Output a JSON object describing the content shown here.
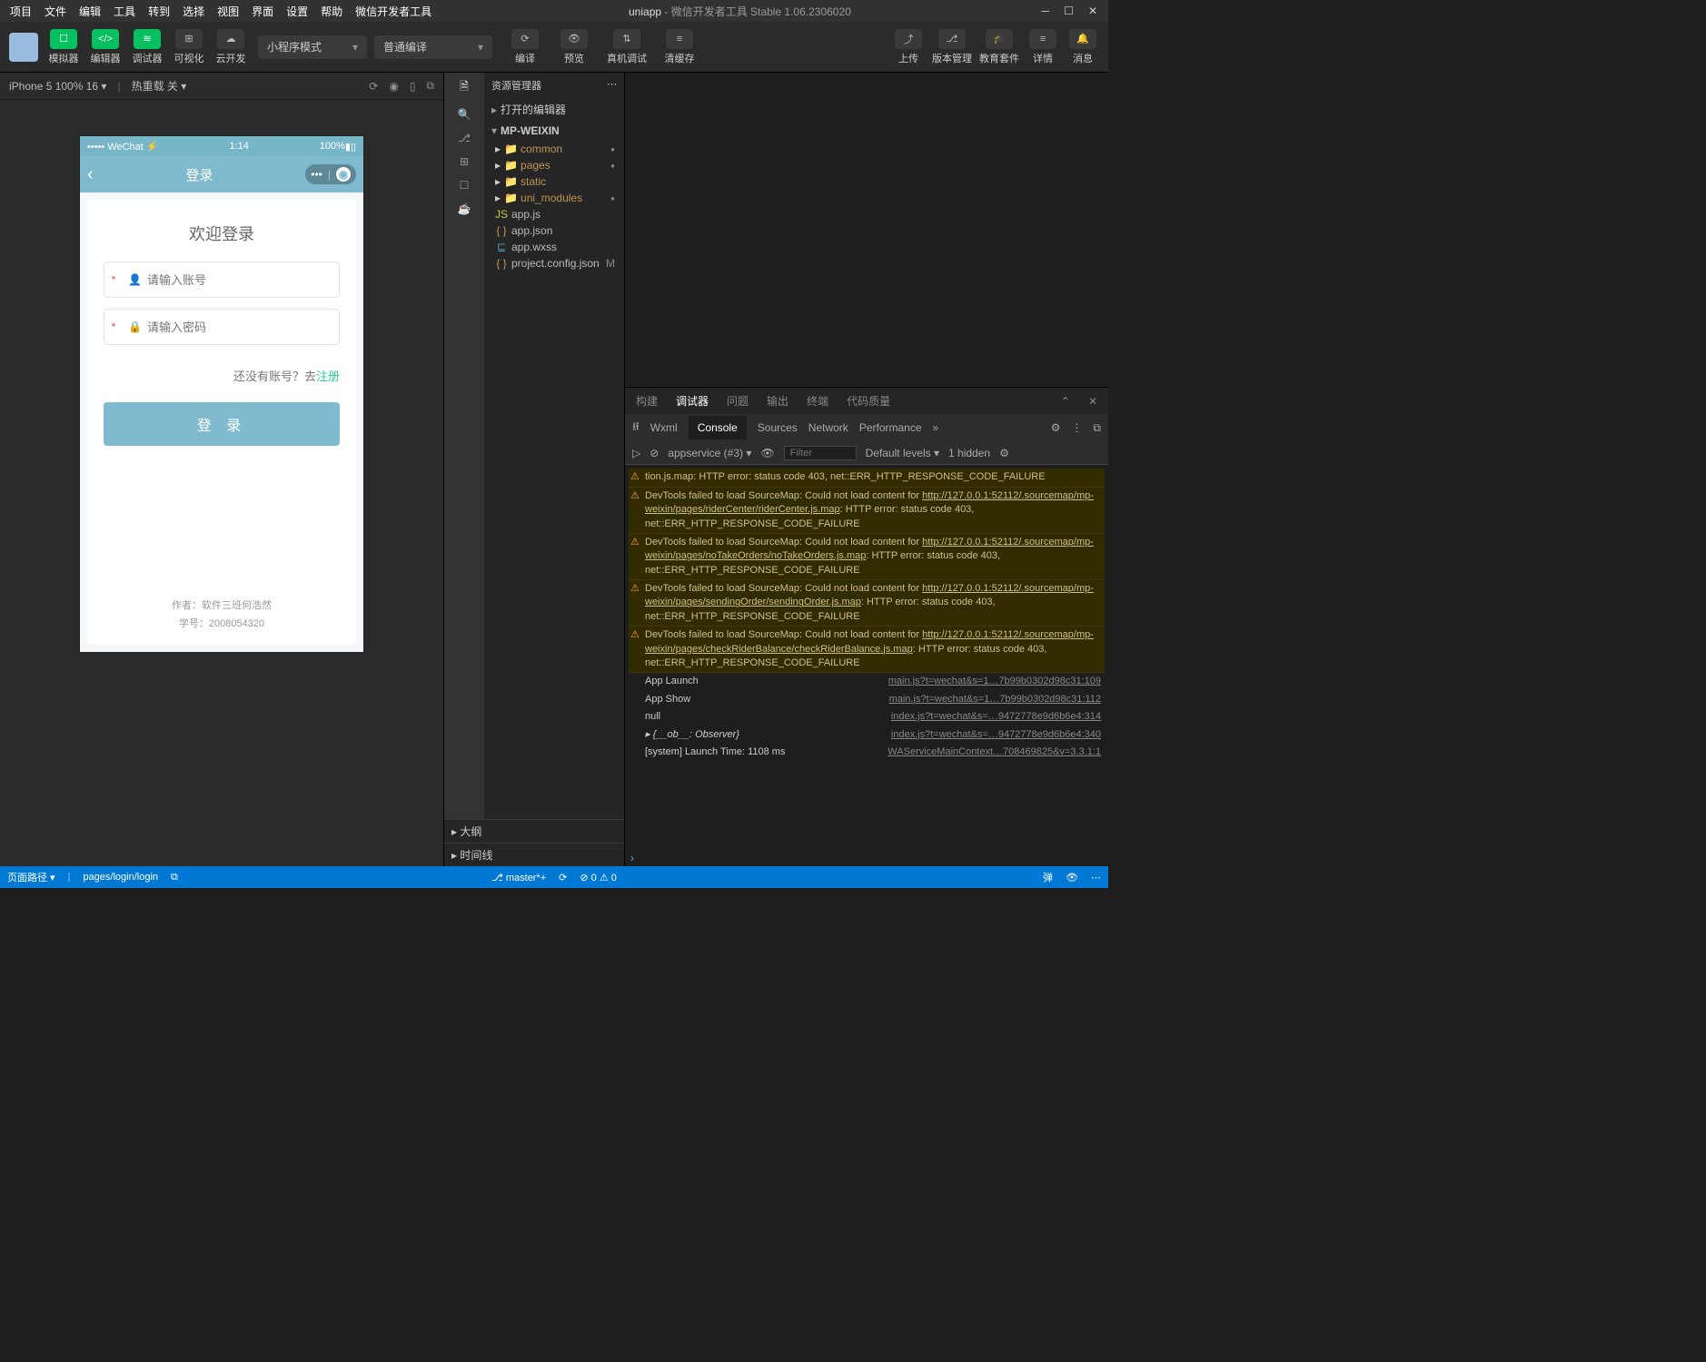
{
  "title": {
    "app": "uniapp",
    "suffix": "微信开发者工具 Stable 1.06.2306020"
  },
  "menu": [
    "项目",
    "文件",
    "编辑",
    "工具",
    "转到",
    "选择",
    "视图",
    "界面",
    "设置",
    "帮助",
    "微信开发者工具"
  ],
  "toolbar": {
    "simulator": "模拟器",
    "editor": "编辑器",
    "debugger": "调试器",
    "visual": "可视化",
    "cloud": "云开发",
    "mode": "小程序模式",
    "compileType": "普通编译",
    "compile": "编译",
    "preview": "预览",
    "realdev": "真机调试",
    "clear": "清缓存",
    "upload": "上传",
    "version": "版本管理",
    "edu": "教育套件",
    "detail": "详情",
    "msg": "消息"
  },
  "simbar": {
    "device": "iPhone 5 100% 16",
    "hot": "热重载 关"
  },
  "phone": {
    "carrier": "WeChat",
    "time": "1:14",
    "battery": "100%",
    "nav": "登录",
    "welcome": "欢迎登录",
    "ph_user": "请输入账号",
    "ph_pwd": "请输入密码",
    "noacct": "还没有账号？去",
    "reg": "注册",
    "login": "登 录",
    "author": "作者：软件三班何浩然",
    "sid": "学号：2008054320"
  },
  "explorer": {
    "title": "资源管理器",
    "opened": "打开的编辑器",
    "root": "MP-WEIXIN",
    "folders": [
      "common",
      "pages",
      "static",
      "uni_modules"
    ],
    "files": [
      {
        "n": "app.js",
        "ic": "js"
      },
      {
        "n": "app.json",
        "ic": "json"
      },
      {
        "n": "app.wxss",
        "ic": "wxss"
      },
      {
        "n": "project.config.json",
        "ic": "json",
        "m": "M"
      }
    ],
    "outline": "大纲",
    "timeline": "时间线"
  },
  "panels": {
    "build": "构建",
    "debugger": "调试器",
    "problems": "问题",
    "output": "输出",
    "terminal": "终端",
    "quality": "代码质量"
  },
  "devtools": {
    "tabs": [
      "Wxml",
      "Console",
      "Sources",
      "Network",
      "Performance"
    ],
    "context": "appservice (#3)",
    "filter_ph": "Filter",
    "levels": "Default levels",
    "hidden": "1 hidden"
  },
  "console": [
    {
      "t": "warn",
      "txt": "tion.js.map: HTTP error: status code 403, net::ERR_HTTP_RESPONSE_CODE_FAILURE"
    },
    {
      "t": "warn",
      "txt": "DevTools failed to load SourceMap: Could not load content for ",
      "lnk": "http://127.0.0.1:52112/.sourcemap/mp-weixin/pages/riderCenter/riderCenter.js.map",
      "tail": ": HTTP error: status code 403, net::ERR_HTTP_RESPONSE_CODE_FAILURE"
    },
    {
      "t": "warn",
      "txt": "DevTools failed to load SourceMap: Could not load content for ",
      "lnk": "http://127.0.0.1:52112/.sourcemap/mp-weixin/pages/noTakeOrders/noTakeOrders.js.map",
      "tail": ": HTTP error: status code 403, net::ERR_HTTP_RESPONSE_CODE_FAILURE"
    },
    {
      "t": "warn",
      "txt": "DevTools failed to load SourceMap: Could not load content for ",
      "lnk": "http://127.0.0.1:52112/.sourcemap/mp-weixin/pages/sendingOrder/sendingOrder.js.map",
      "tail": ": HTTP error: status code 403, net::ERR_HTTP_RESPONSE_CODE_FAILURE"
    },
    {
      "t": "warn",
      "txt": "DevTools failed to load SourceMap: Could not load content for ",
      "lnk": "http://127.0.0.1:52112/.sourcemap/mp-weixin/pages/checkRiderBalance/checkRiderBalance.js.map",
      "tail": ": HTTP error: status code 403, net::ERR_HTTP_RESPONSE_CODE_FAILURE"
    },
    {
      "t": "log",
      "txt": "App Launch",
      "src": "main.js?t=wechat&s=1…7b99b0302d98c31:109"
    },
    {
      "t": "log",
      "txt": "App Show",
      "src": "main.js?t=wechat&s=1…7b99b0302d98c31:112"
    },
    {
      "t": "log",
      "txt": "null",
      "src": "index.js?t=wechat&s=…9472778e9d6b6e4:314"
    },
    {
      "t": "log",
      "txt": "▸ {__ob__: Observer}",
      "src": "index.js?t=wechat&s=…9472778e9d6b6e4:340",
      "it": true
    },
    {
      "t": "log",
      "txt": "[system] Launch Time: 1108 ms",
      "src": "WAServiceMainContext…708469825&v=3.3.1:1"
    }
  ],
  "status": {
    "route": "页面路径",
    "path": "pages/login/login",
    "branch": "master*+",
    "errwarn": "⊘ 0 ⚠ 0"
  }
}
